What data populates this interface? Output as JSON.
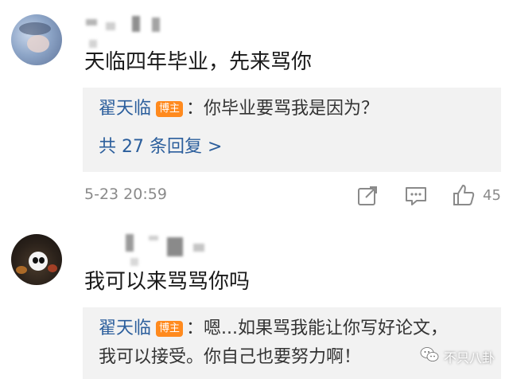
{
  "comments": [
    {
      "text": "天临四年毕业，先来骂你",
      "reply": {
        "user": "翟天临",
        "badge": "博主",
        "text": "：你毕业要骂我是因为？",
        "more": "共 27 条回复 >"
      },
      "time": "5-23 20:59",
      "likes": "45",
      "icons": [
        "share-icon",
        "comment-icon",
        "like-icon"
      ]
    },
    {
      "text": "我可以来骂骂你吗",
      "reply": {
        "user": "翟天临",
        "badge": "博主",
        "line1": "：嗯...如果骂我能让你写好论文，",
        "line2": "我可以接受。你自己也要努力啊！"
      }
    }
  ],
  "watermark": "不只八卦",
  "colors": {
    "link": "#2b5e9c",
    "badge": "#ff8a1e",
    "reply_bg": "#f2f2f2",
    "meta": "#8a8a8a"
  }
}
